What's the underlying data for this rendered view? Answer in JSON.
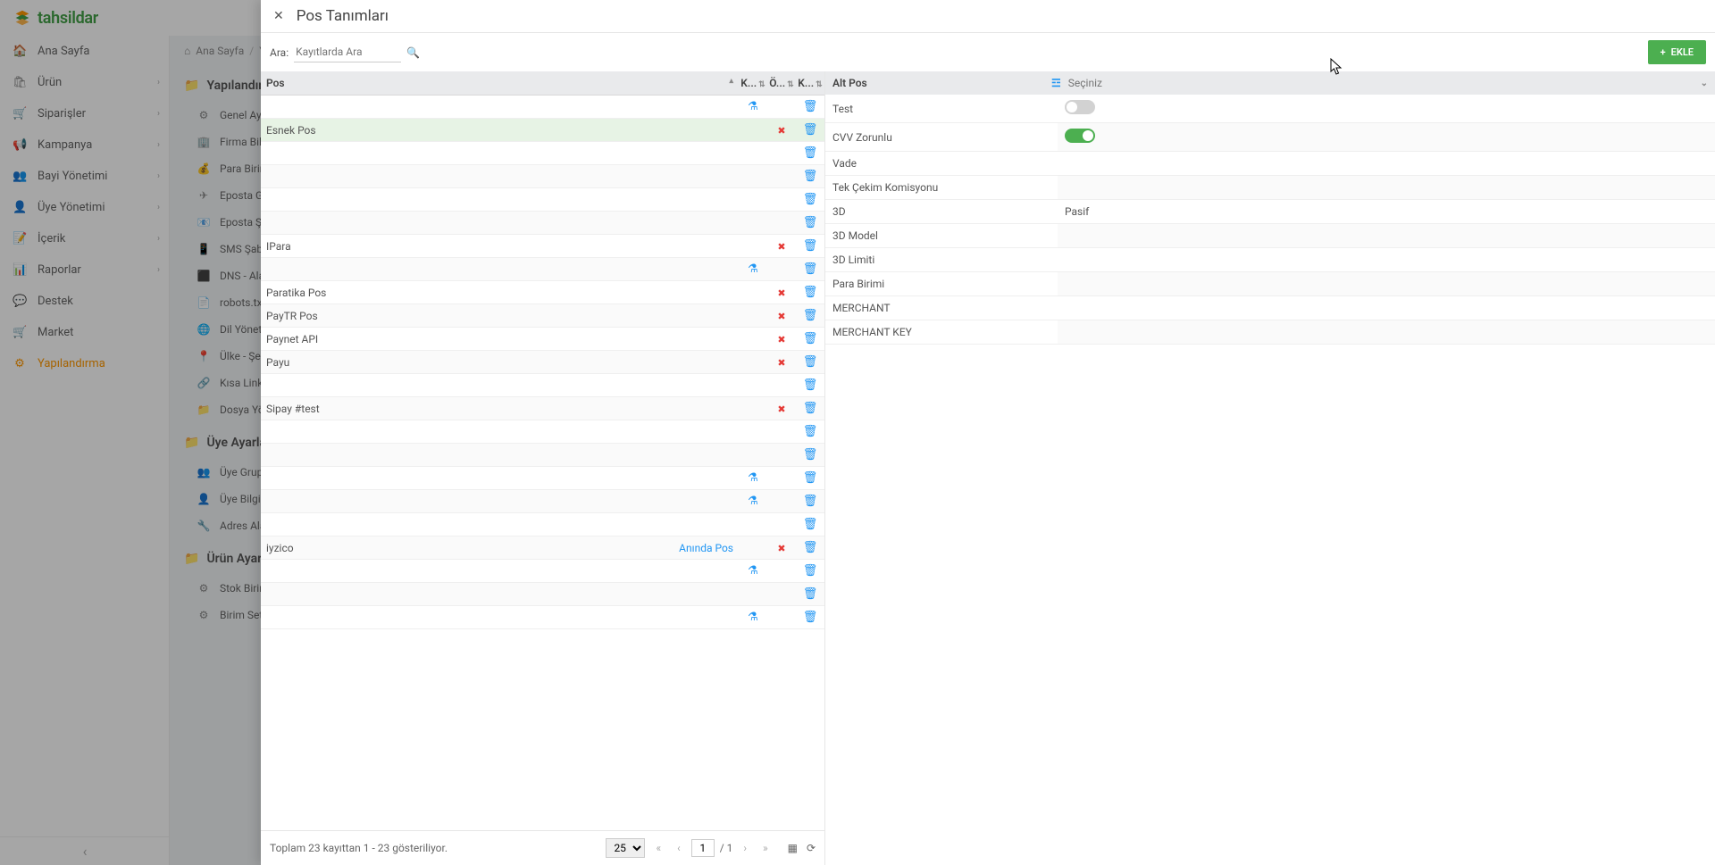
{
  "app": {
    "logo_text": "tahsildar"
  },
  "sidebar": {
    "items": [
      {
        "icon": "🏠",
        "label": "Ana Sayfa",
        "chev": false
      },
      {
        "icon": "🛍",
        "label": "Ürün",
        "chev": true
      },
      {
        "icon": "🛒",
        "label": "Siparişler",
        "chev": true
      },
      {
        "icon": "📢",
        "label": "Kampanya",
        "chev": true
      },
      {
        "icon": "👥",
        "label": "Bayi Yönetimi",
        "chev": true
      },
      {
        "icon": "👤",
        "label": "Üye Yönetimi",
        "chev": true
      },
      {
        "icon": "📝",
        "label": "İçerik",
        "chev": true
      },
      {
        "icon": "📊",
        "label": "Raporlar",
        "chev": true
      },
      {
        "icon": "💬",
        "label": "Destek",
        "chev": false
      },
      {
        "icon": "🛒",
        "label": "Market",
        "chev": false
      }
    ],
    "active": {
      "icon": "⚙",
      "label": "Yapılandırma"
    }
  },
  "breadcrumb": {
    "home": "Ana Sayfa",
    "current": "Ya..."
  },
  "sections": [
    {
      "title": "Yapılandırma",
      "items": [
        {
          "icon": "⚙",
          "label": "Genel Ayar..."
        },
        {
          "icon": "🏢",
          "label": "Firma Bilgil..."
        },
        {
          "icon": "💰",
          "label": "Para Birimi..."
        },
        {
          "icon": "✈",
          "label": "Eposta Gör..."
        },
        {
          "icon": "📧",
          "label": "Eposta Şab..."
        },
        {
          "icon": "📱",
          "label": "SMS Şablo..."
        },
        {
          "icon": "⬛",
          "label": "DNS - Alan..."
        },
        {
          "icon": "📄",
          "label": "robots.txt"
        },
        {
          "icon": "🌐",
          "label": "Dil Yönetim..."
        },
        {
          "icon": "📍",
          "label": "Ülke - Şehi..."
        },
        {
          "icon": "🔗",
          "label": "Kısa Link"
        },
        {
          "icon": "📁",
          "label": "Dosya Yön..."
        }
      ]
    },
    {
      "title": "Üye Ayarları",
      "items": [
        {
          "icon": "👥",
          "label": "Üye Grupla..."
        },
        {
          "icon": "👤",
          "label": "Üye Bilgi A..."
        },
        {
          "icon": "🔧",
          "label": "Adres Alan..."
        }
      ]
    },
    {
      "title": "Ürün Ayarları",
      "items": [
        {
          "icon": "⚙",
          "label": "Stok Birim..."
        },
        {
          "icon": "⚙",
          "label": "Birim Setle..."
        }
      ]
    }
  ],
  "panel": {
    "title": "Pos Tanımları",
    "search_label": "Ara:",
    "search_placeholder": "Kayıtlarda Ara",
    "add_button": "EKLE",
    "columns": {
      "pos": "Pos",
      "k1": "K...",
      "o": "Ö...",
      "k2": "K..."
    },
    "rows": [
      {
        "name": "",
        "flask": true,
        "xred": false
      },
      {
        "name": "Esnek Pos",
        "flask": false,
        "xred": true,
        "highlight": true
      },
      {
        "name": "",
        "flask": false,
        "xred": false
      },
      {
        "name": "",
        "flask": false,
        "xred": false
      },
      {
        "name": "",
        "flask": false,
        "xred": false
      },
      {
        "name": "",
        "flask": false,
        "xred": false
      },
      {
        "name": "IPara",
        "flask": false,
        "xred": true
      },
      {
        "name": "",
        "flask": true,
        "xred": false
      },
      {
        "name": "Paratika Pos",
        "flask": false,
        "xred": true
      },
      {
        "name": "PayTR Pos",
        "flask": false,
        "xred": true
      },
      {
        "name": "Paynet API",
        "flask": false,
        "xred": true
      },
      {
        "name": "Payu",
        "flask": false,
        "xred": true
      },
      {
        "name": "",
        "flask": false,
        "xred": false
      },
      {
        "name": "Sipay #test",
        "flask": false,
        "xred": true
      },
      {
        "name": "",
        "flask": false,
        "xred": false
      },
      {
        "name": "",
        "flask": false,
        "xred": false
      },
      {
        "name": "",
        "flask": true,
        "xred": false
      },
      {
        "name": "",
        "flask": true,
        "xred": false
      },
      {
        "name": "",
        "flask": false,
        "xred": false
      },
      {
        "name": "iyzico",
        "instant": "Anında Pos",
        "flask": false,
        "xred": true
      },
      {
        "name": "",
        "flask": true,
        "xred": false
      },
      {
        "name": "",
        "flask": false,
        "xred": false
      },
      {
        "name": "",
        "flask": true,
        "xred": false
      }
    ],
    "pager": {
      "info": "Toplam 23 kayıttan 1 - 23 gösteriliyor.",
      "page_size": "25",
      "page": "1",
      "total": "/ 1"
    },
    "detail": {
      "header_label": "Alt Pos",
      "header_placeholder": "Seçiniz",
      "rows": [
        {
          "label": "Test",
          "type": "toggle_off"
        },
        {
          "label": "CVV Zorunlu",
          "type": "toggle_on"
        },
        {
          "label": "Vade",
          "value": ""
        },
        {
          "label": "Tek Çekim Komisyonu",
          "value": ""
        },
        {
          "label": "3D",
          "value": "Pasif"
        },
        {
          "label": "3D Model",
          "value": ""
        },
        {
          "label": "3D Limiti",
          "value": ""
        },
        {
          "label": "Para Birimi",
          "value": ""
        },
        {
          "label": "MERCHANT",
          "value": ""
        },
        {
          "label": "MERCHANT KEY",
          "value": ""
        }
      ]
    }
  }
}
